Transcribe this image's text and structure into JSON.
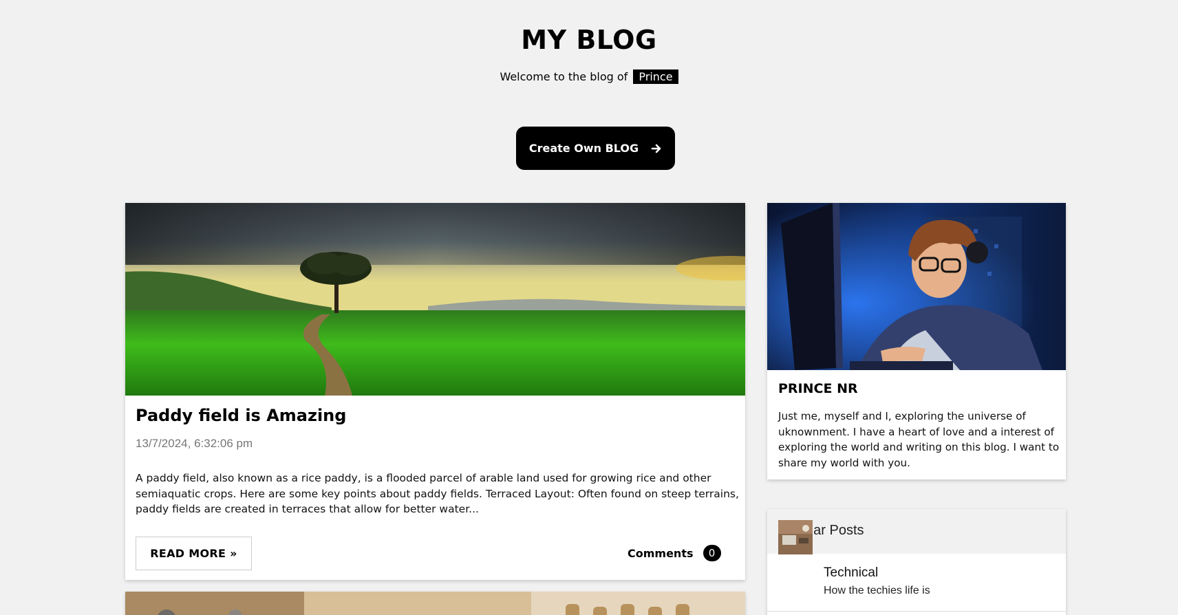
{
  "header": {
    "title": "MY BLOG",
    "tagline_prefix": "Welcome to the blog of",
    "owner_name": "Prince",
    "create_button_label": "Create Own BLOG",
    "create_button_icon": "arrow-right-icon"
  },
  "posts": [
    {
      "title": "Paddy field is Amazing",
      "date": "13/7/2024, 6:32:06 pm",
      "excerpt": "A paddy field, also known as a rice paddy, is a flooded parcel of arable land used for growing rice and other semiaquatic crops. Here are some key points about paddy fields. Terraced Layout: Often found on steep terrains, paddy fields are created in terraces that allow for better water...",
      "read_more_label": "READ MORE »",
      "comments_label": "Comments",
      "comments_count": "0"
    }
  ],
  "sidebar": {
    "profile": {
      "name": "PRINCE NR",
      "bio": "Just me, myself and I, exploring the universe of uknownment. I have a heart of love and a interest of exploring the world and writing on this blog. I want to share my world with you."
    },
    "popular": {
      "heading": "Popular Posts",
      "items": [
        {
          "title": "Technical",
          "subtitle": "How the techies life is"
        }
      ]
    }
  },
  "colors": {
    "background": "#f1f1f1",
    "accent": "#000000",
    "card": "#ffffff"
  }
}
